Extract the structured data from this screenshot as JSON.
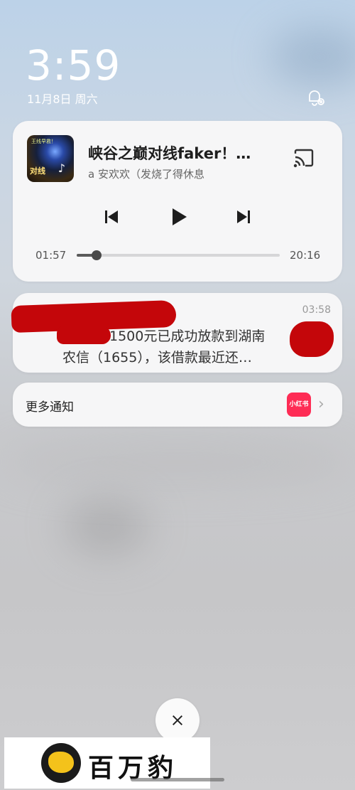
{
  "lockscreen": {
    "time": "3:59",
    "date": "11月8日 周六"
  },
  "media": {
    "title": "峡谷之巅对线faker！…",
    "artist": "a 安欢欢（发烧了得休息",
    "cover_caption": "对线",
    "cover_top": "王线早救！",
    "time_elapsed": "01:57",
    "time_total": "20:16",
    "progress": 0.097,
    "icons": [
      "previous-track-icon",
      "play-icon",
      "next-track-icon",
      "cast-icon"
    ]
  },
  "notification": {
    "time": "03:58",
    "line1": "1500元已成功放款到湖南",
    "line2": "农信（1655），该借款最近还…",
    "redaction_color": "#c4060a"
  },
  "more": {
    "label": "更多通知",
    "app_icon_label": "小红书",
    "app_icon_color": "#fe2c55"
  },
  "watermark": {
    "text": "百万豹"
  }
}
